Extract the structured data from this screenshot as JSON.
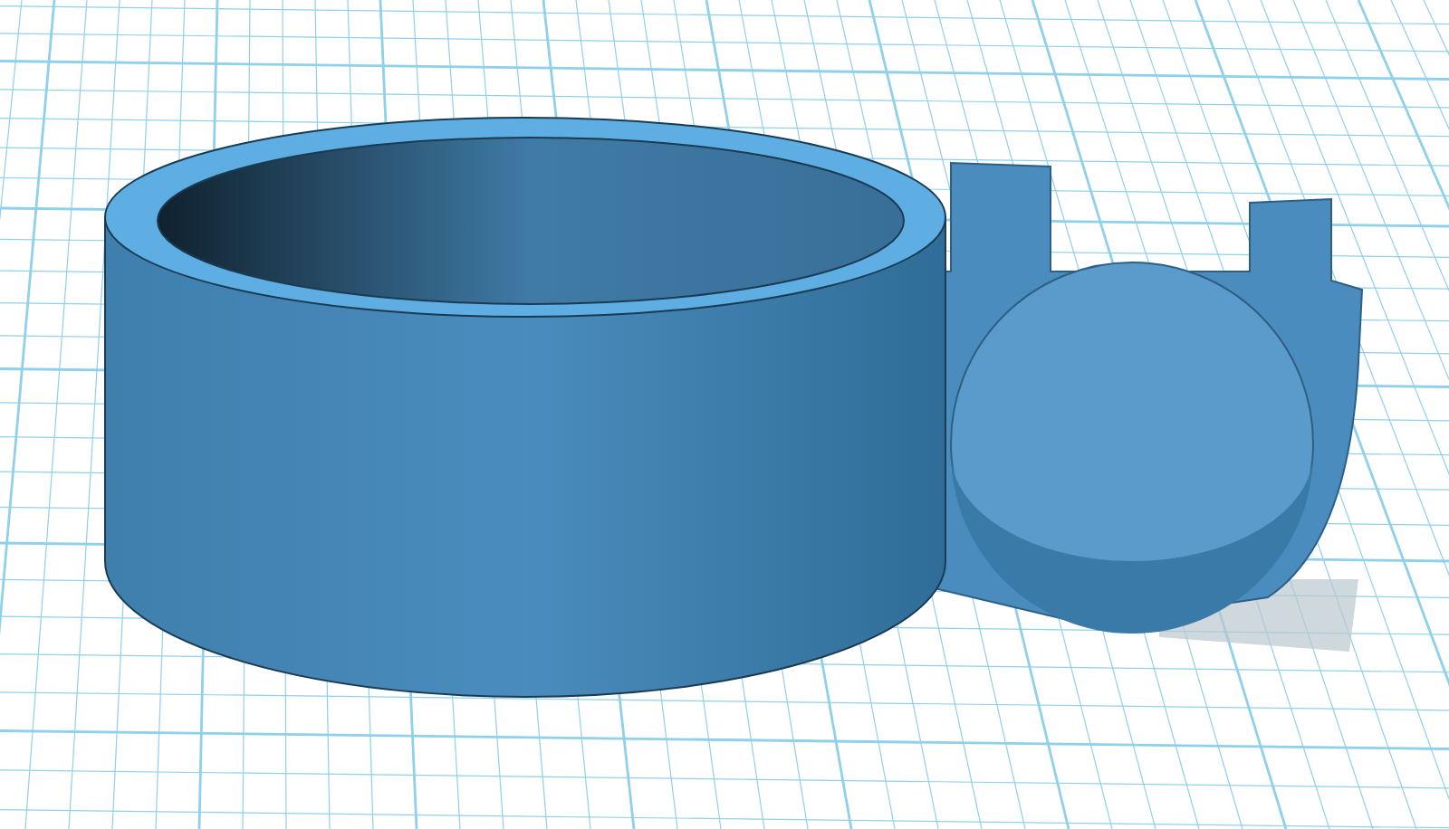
{
  "viewport": {
    "grid": true,
    "model_shadow": true
  }
}
